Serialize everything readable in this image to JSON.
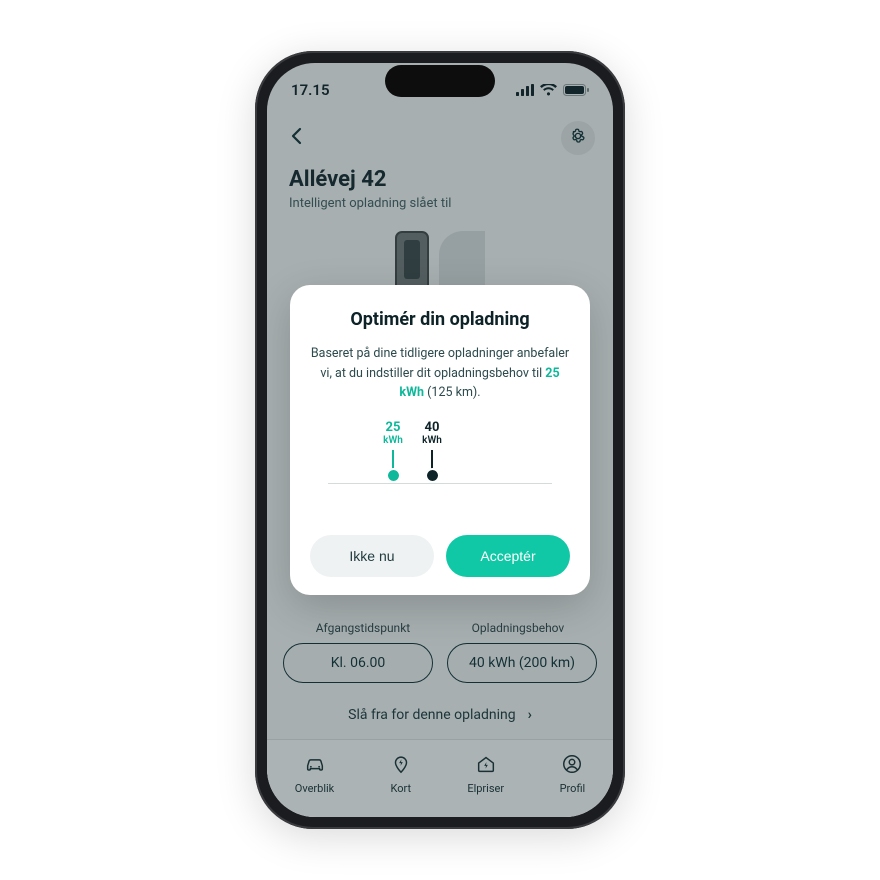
{
  "status": {
    "time": "17.15"
  },
  "header": {
    "title": "Allévej 42",
    "subtitle": "Intelligent opladning slået til"
  },
  "controls": {
    "departure_label": "Afgangstidspunkt",
    "need_label": "Opladningsbehov",
    "departure_value": "Kl. 06.00",
    "need_value": "40 kWh (200 km)",
    "disable_text": "Slå fra for denne opladning"
  },
  "tabs": {
    "overview": "Overblik",
    "map": "Kort",
    "prices": "Elpriser",
    "profile": "Profil"
  },
  "modal": {
    "title": "Optimér din opladning",
    "body_prefix": "Baseret på dine tidligere opladninger anbefaler vi, at du indstiller dit opladningsbehov til ",
    "recommended_strong": "25 kWh",
    "body_suffix": " (125 km).",
    "rec_value": "25",
    "rec_unit": "kWh",
    "cur_value": "40",
    "cur_unit": "kWh",
    "decline": "Ikke nu",
    "accept": "Acceptér"
  }
}
